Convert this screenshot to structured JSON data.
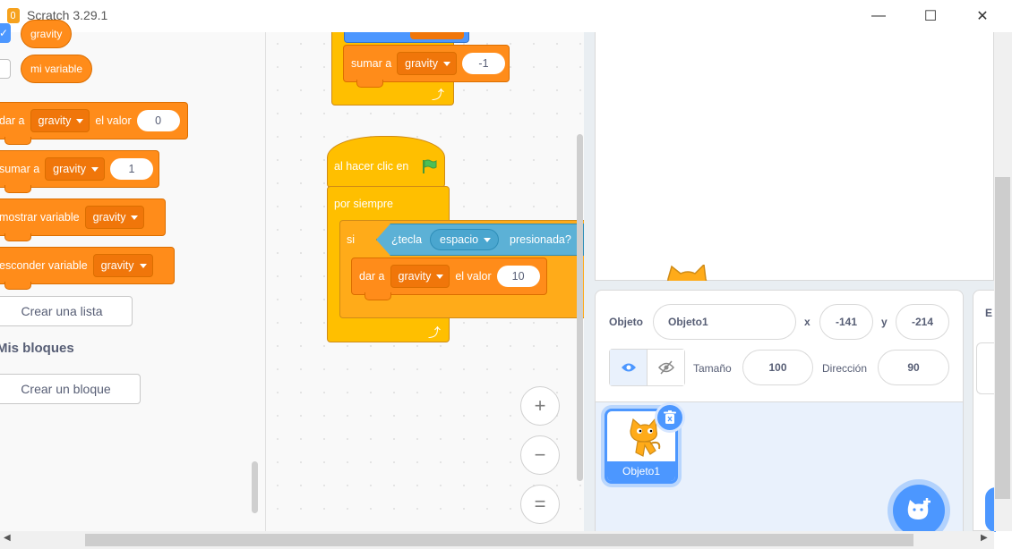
{
  "window": {
    "title": "Scratch 3.29.1",
    "minimize": "—",
    "maximize": "☐",
    "close": "✕"
  },
  "palette": {
    "variables": [
      {
        "name": "gravity",
        "checked": true
      },
      {
        "name": "mi variable",
        "checked": false
      }
    ],
    "blocks": {
      "set": {
        "label": "dar a",
        "var": "gravity",
        "suffix": "el valor",
        "value": "0"
      },
      "change": {
        "label": "sumar a",
        "var": "gravity",
        "value": "1"
      },
      "show": {
        "label": "mostrar variable",
        "var": "gravity"
      },
      "hide": {
        "label": "esconder variable",
        "var": "gravity"
      }
    },
    "make_list": "Crear una lista",
    "my_blocks_heading": "Mis bloques",
    "make_block": "Crear un bloque"
  },
  "workspace": {
    "top_stack": {
      "change_label": "sumar a",
      "change_var": "gravity",
      "change_value": "-1",
      "partial_var": "gravity"
    },
    "script": {
      "hat": "al hacer clic en",
      "forever": "por siempre",
      "if": "si",
      "sensing_prefix": "¿tecla",
      "sensing_key": "espacio",
      "sensing_suffix": "presionada?",
      "set_label": "dar a",
      "set_var": "gravity",
      "set_suffix": "el valor",
      "set_value": "10"
    },
    "zoom_in": "+",
    "zoom_out": "−",
    "zoom_reset": "="
  },
  "sprite_info": {
    "sprite_label": "Objeto",
    "sprite_name": "Objeto1",
    "x_label": "x",
    "x_value": "-141",
    "y_label": "y",
    "y_value": "-214",
    "size_label": "Tamaño",
    "size_value": "100",
    "direction_label": "Dirección",
    "direction_value": "90"
  },
  "sprite_list": {
    "items": [
      {
        "name": "Objeto1",
        "selected": true
      }
    ]
  },
  "stage_panel": {
    "label": "E"
  },
  "colors": {
    "variables": "#ff8c1a",
    "control": "#ffbf00",
    "events": "#ffbf00",
    "sensing": "#5cb1d6",
    "accent": "#4c97ff"
  }
}
